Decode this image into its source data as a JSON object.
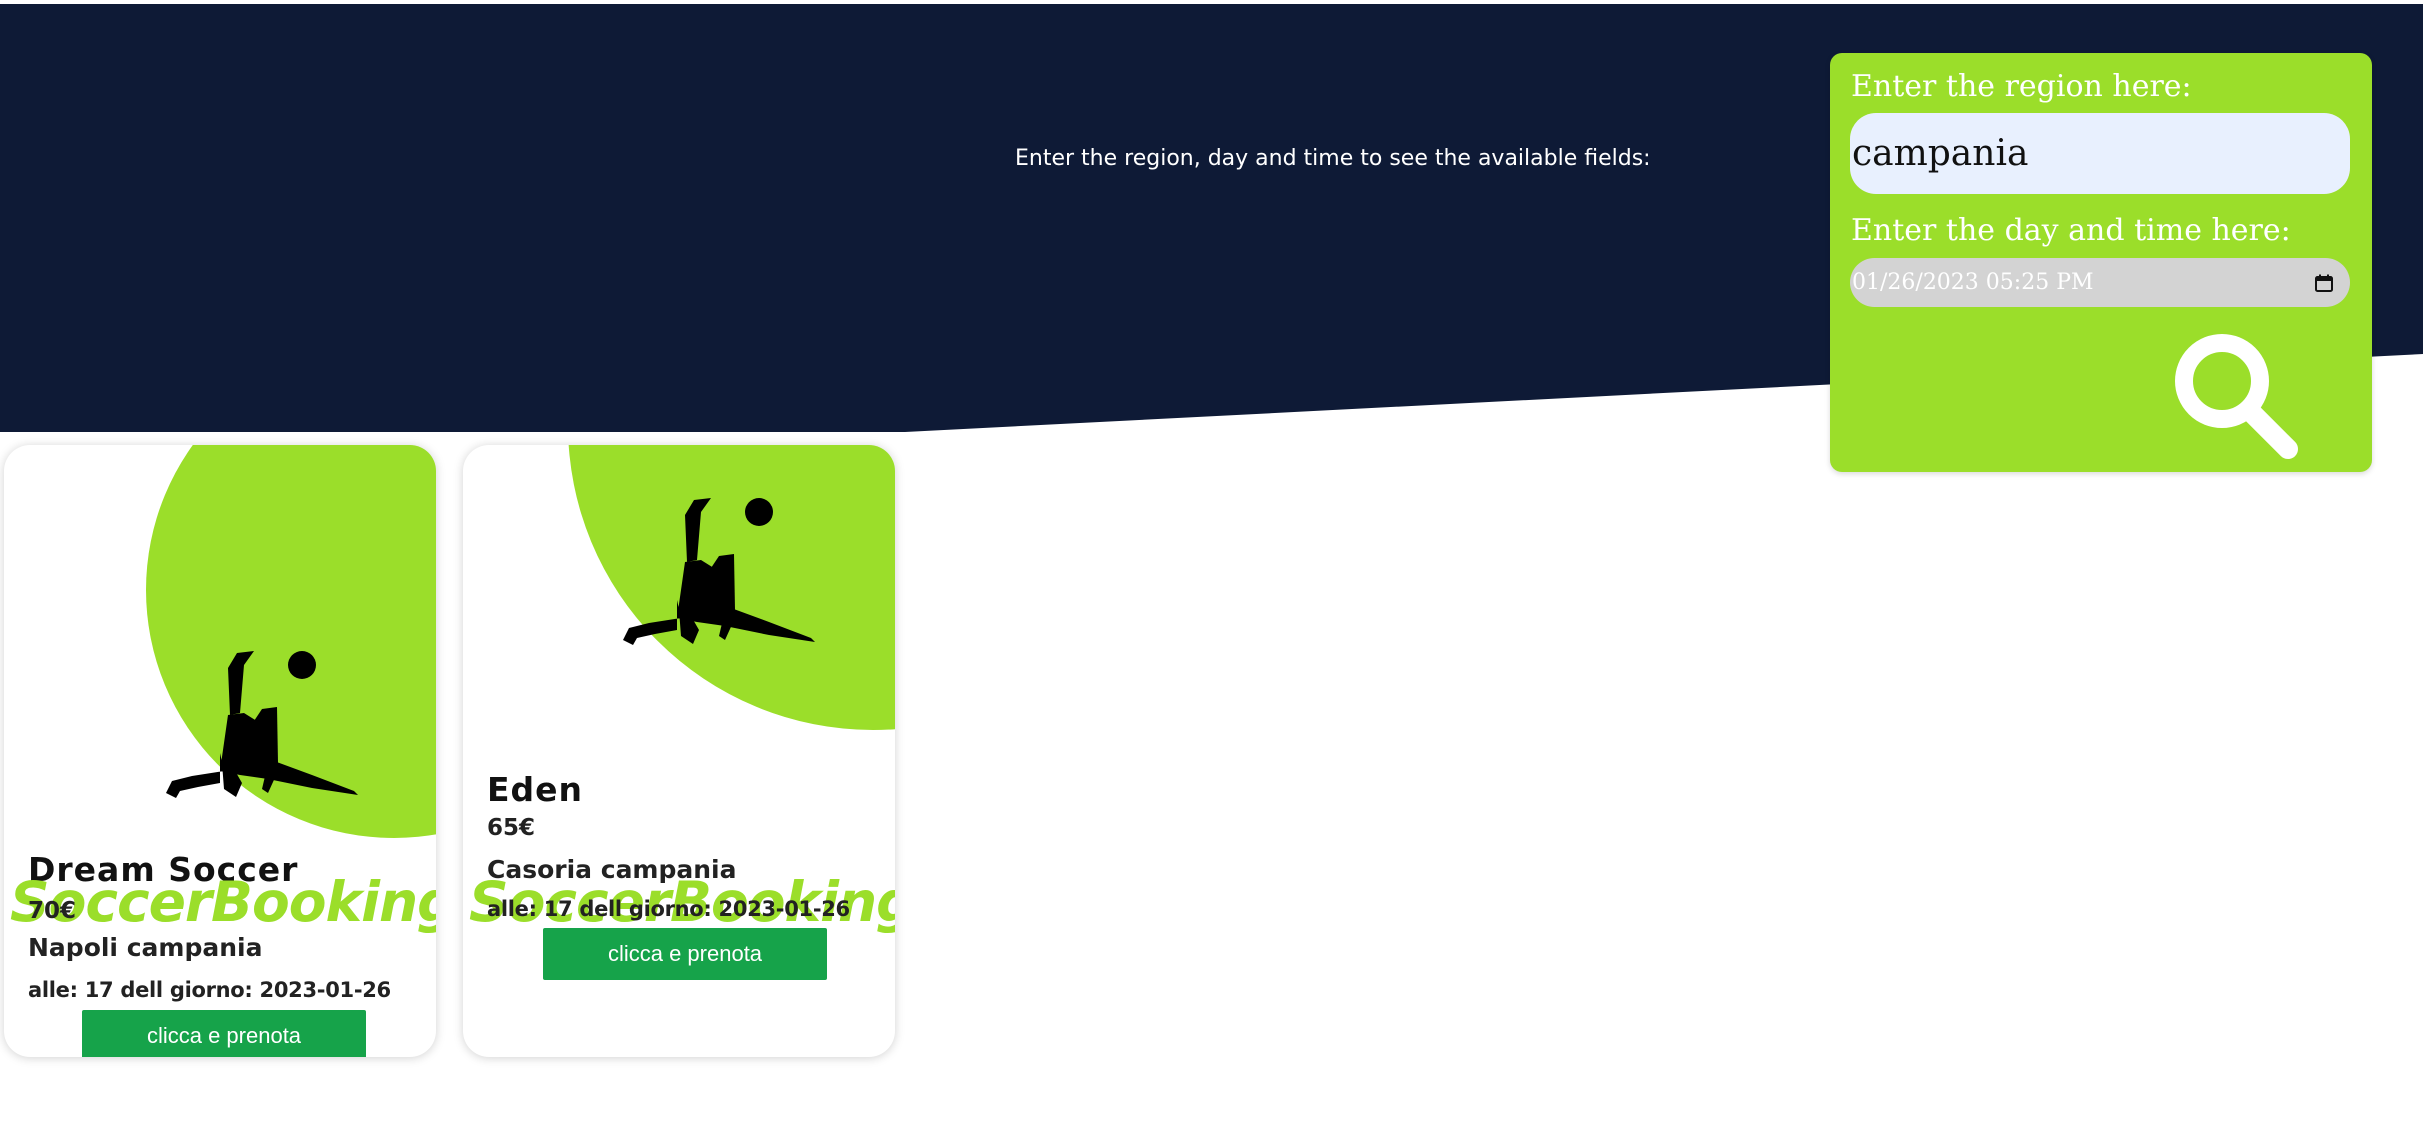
{
  "header": {
    "instruction": "Enter the region, day and time to see the available fields:"
  },
  "search": {
    "region_label": "Enter the region here:",
    "region_value": "campania",
    "datetime_label": "Enter the day and time here:",
    "datetime_value": "01/26/2023 05:25 PM",
    "button_icon": "search-icon"
  },
  "cards": [
    {
      "name": "Dream Soccer",
      "price": "70€",
      "location": "Napoli campania",
      "when": "alle: 17 dell giorno: 2023-01-26",
      "watermark": "SoccerBooking",
      "button_label": "clicca e prenota",
      "image_icon": "bicycle-kick-player-icon"
    },
    {
      "name": "Eden",
      "price": "65€",
      "location": "Casoria campania",
      "when": "alle: 17 dell giorno: 2023-01-26",
      "watermark": "SoccerBooking",
      "button_label": "clicca e prenota",
      "image_icon": "bicycle-kick-player-icon"
    }
  ],
  "colors": {
    "header_bg": "#0e1a36",
    "accent_green": "#9bde2a",
    "button_green": "#16a34a",
    "input_bg": "#e8f0fe",
    "datetime_bg": "#d3d3d3"
  }
}
